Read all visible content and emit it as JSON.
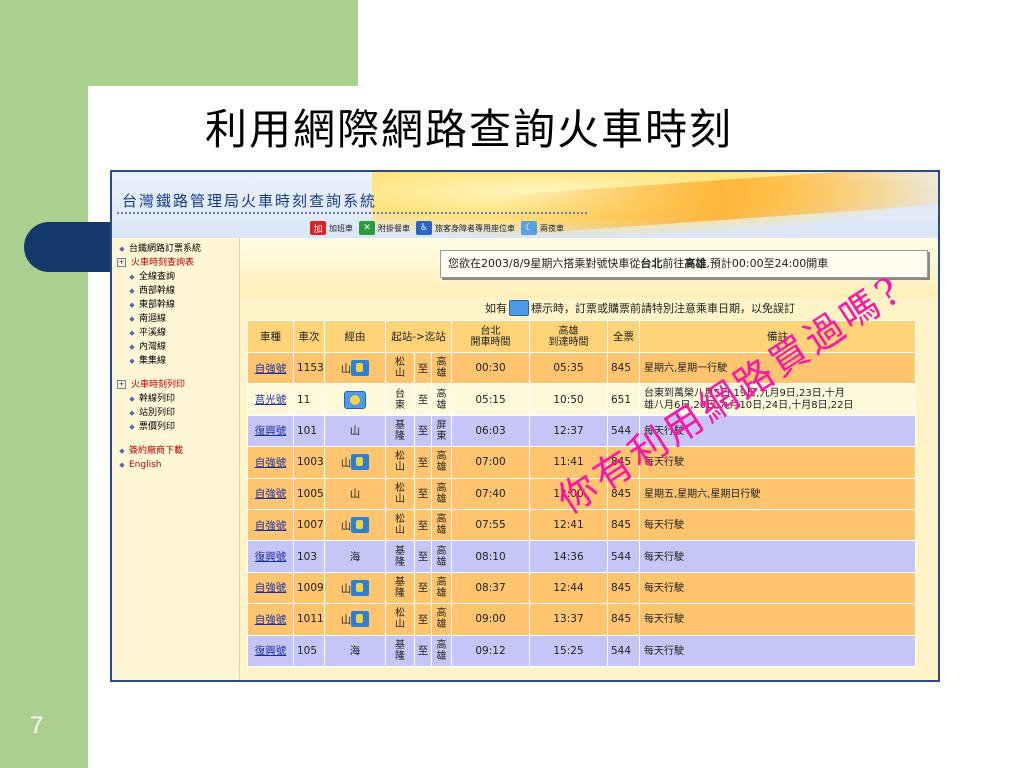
{
  "slide": {
    "title": "利用網際網路查詢火車時刻",
    "number": "7",
    "annotation": "你有利用網路買過嗎?"
  },
  "app": {
    "title": "台灣鐵路管理局火車時刻查詢系統",
    "nav": [
      {
        "icon": "加",
        "label": "加班車",
        "icon_name": "extra-train-icon"
      },
      {
        "icon": "✕",
        "label": "附掛餐車",
        "icon_name": "dining-car-icon"
      },
      {
        "icon": "♿",
        "label": "旅客身障者專用座位車",
        "icon_name": "wheelchair-icon"
      },
      {
        "icon": "☾",
        "label": "兩夜車",
        "icon_name": "night-train-icon"
      }
    ]
  },
  "sidebar": {
    "items": [
      {
        "label": "台鐵網路訂票系統",
        "type": "bullet",
        "red": false
      },
      {
        "label": "火車時刻查詢表",
        "type": "plus",
        "red": true
      },
      {
        "label": "全線查詢",
        "type": "sub",
        "red": false
      },
      {
        "label": "西部幹線",
        "type": "sub",
        "red": false
      },
      {
        "label": "東部幹線",
        "type": "sub",
        "red": false
      },
      {
        "label": "南迴線",
        "type": "sub",
        "red": false
      },
      {
        "label": "平溪線",
        "type": "sub",
        "red": false
      },
      {
        "label": "內灣線",
        "type": "sub",
        "red": false
      },
      {
        "label": "集集線",
        "type": "sub",
        "red": false
      },
      {
        "label": "火車時刻列印",
        "type": "plus",
        "red": true,
        "gap": true
      },
      {
        "label": "幹線列印",
        "type": "sub",
        "red": false
      },
      {
        "label": "站別列印",
        "type": "sub",
        "red": false
      },
      {
        "label": "票價列印",
        "type": "sub",
        "red": false
      },
      {
        "label": "簽約廠商下載",
        "type": "bullet",
        "red": true,
        "gap": true
      },
      {
        "label": "English",
        "type": "bullet",
        "red": true
      }
    ]
  },
  "notice": {
    "prefix": "您欲在2003/8/9星期六搭乘對號快車從",
    "from": "台北",
    "mid": "前往",
    "to": "高雄",
    "suffix": ",預計00:00至24:00開車"
  },
  "hint": {
    "before": "如有",
    "after": "標示時，訂票或購票前請特別注意乘車日期，以免誤訂"
  },
  "table": {
    "headers": {
      "type": "車種",
      "num": "車次",
      "via": "經由",
      "route": "起站->迄站",
      "dep": "台北\n開車時間",
      "arr": "高雄\n到達時間",
      "fare": "全票",
      "note": "備註"
    },
    "rows": [
      {
        "style": "orange",
        "type": "自強號",
        "num": "1153",
        "via": "山",
        "via_icon": "wheelchair",
        "from": "松\n山",
        "to_word": "至",
        "to": "高\n雄",
        "dep": "00:30",
        "arr": "05:35",
        "fare": "845",
        "note": "星期六,星期一行駛"
      },
      {
        "style": "pale",
        "type": "莒光號",
        "num": "11",
        "via": "",
        "via_icon": "night",
        "from": "台\n東",
        "to_word": "至",
        "to": "高\n雄",
        "dep": "05:15",
        "arr": "10:50",
        "fare": "651",
        "note": "台東到萬榮八月5日,19日,九月9日,23日,十月\n雄八月6日,20日,九月10日,24日,十月8日,22日"
      },
      {
        "style": "lav",
        "type": "復興號",
        "num": "101",
        "via": "山",
        "via_icon": "",
        "from": "基\n隆",
        "to_word": "至",
        "to": "屏\n東",
        "dep": "06:03",
        "arr": "12:37",
        "fare": "544",
        "note": "每天行駛"
      },
      {
        "style": "orange",
        "type": "自強號",
        "num": "1003",
        "via": "山",
        "via_icon": "wheelchair",
        "from": "松\n山",
        "to_word": "至",
        "to": "高\n雄",
        "dep": "07:00",
        "arr": "11:41",
        "fare": "845",
        "note": "每天行駛"
      },
      {
        "style": "orange",
        "type": "自強號",
        "num": "1005",
        "via": "山",
        "via_icon": "",
        "from": "松\n山",
        "to_word": "至",
        "to": "高\n雄",
        "dep": "07:40",
        "arr": "12:00",
        "fare": "845",
        "note": "星期五,星期六,星期日行駛"
      },
      {
        "style": "orange",
        "type": "自強號",
        "num": "1007",
        "via": "山",
        "via_icon": "wheelchair",
        "from": "松\n山",
        "to_word": "至",
        "to": "高\n雄",
        "dep": "07:55",
        "arr": "12:41",
        "fare": "845",
        "note": "每天行駛"
      },
      {
        "style": "lav",
        "type": "復興號",
        "num": "103",
        "via": "海",
        "via_icon": "",
        "from": "基\n隆",
        "to_word": "至",
        "to": "高\n雄",
        "dep": "08:10",
        "arr": "14:36",
        "fare": "544",
        "note": "每天行駛"
      },
      {
        "style": "orange",
        "type": "自強號",
        "num": "1009",
        "via": "山",
        "via_icon": "wheelchair",
        "from": "基\n隆",
        "to_word": "至",
        "to": "高\n雄",
        "dep": "08:37",
        "arr": "12:44",
        "fare": "845",
        "note": "每天行駛"
      },
      {
        "style": "orange",
        "type": "自強號",
        "num": "1011",
        "via": "山",
        "via_icon": "wheelchair",
        "from": "松\n山",
        "to_word": "至",
        "to": "高\n雄",
        "dep": "09:00",
        "arr": "13:37",
        "fare": "845",
        "note": "每天行駛"
      },
      {
        "style": "lav",
        "type": "復興號",
        "num": "105",
        "via": "海",
        "via_icon": "",
        "from": "基\n隆",
        "to_word": "至",
        "to": "高\n雄",
        "dep": "09:12",
        "arr": "15:25",
        "fare": "544",
        "note": "每天行駛"
      }
    ]
  }
}
